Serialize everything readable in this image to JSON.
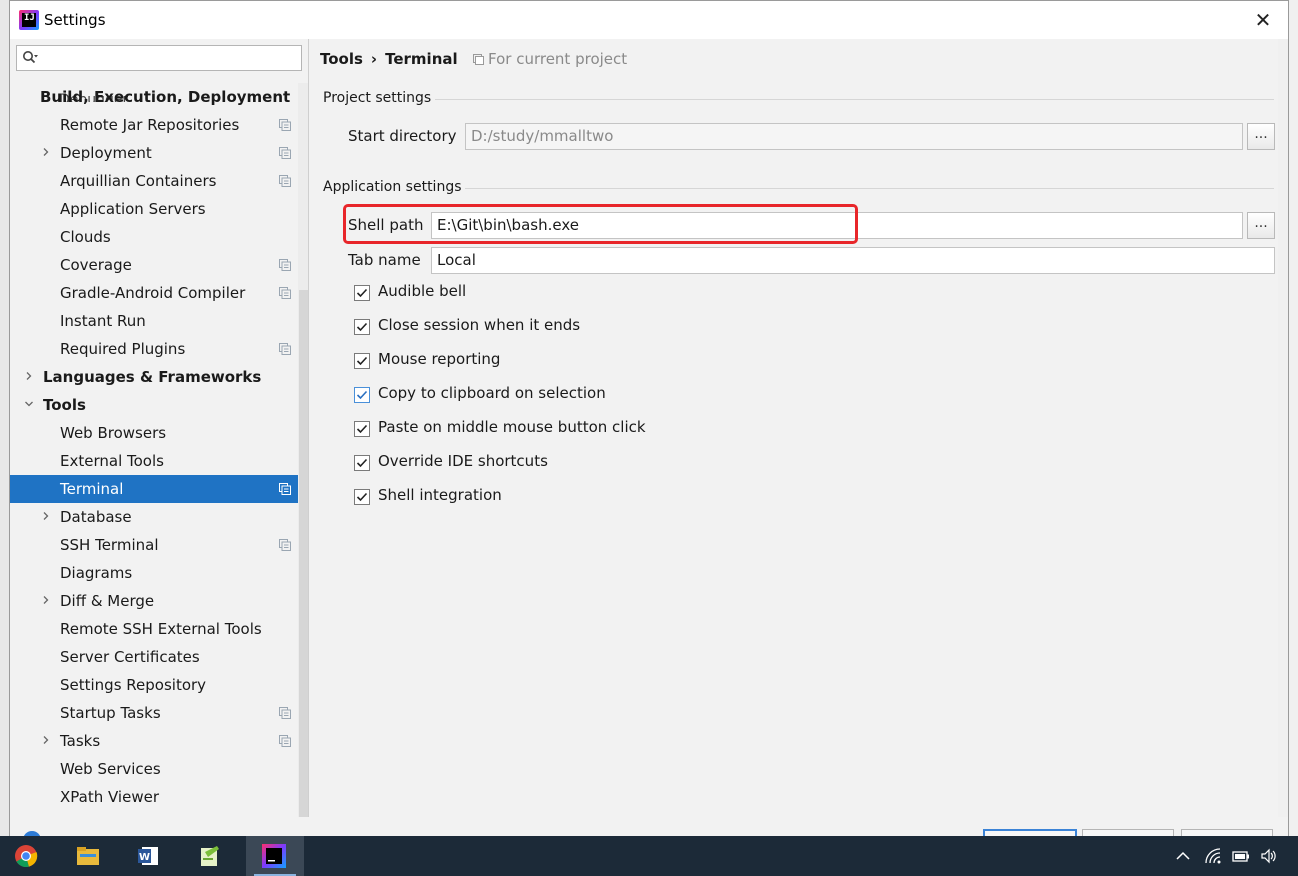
{
  "window": {
    "title": "Settings",
    "close_glyph": "✕"
  },
  "search": {
    "placeholder": ""
  },
  "tree": {
    "header": "Build, Execution, Deployment",
    "partial_item": "Debugger",
    "items": [
      {
        "label": "Remote Jar Repositories",
        "indent": 2,
        "expandable": false,
        "project_icon": true,
        "bold": false
      },
      {
        "label": "Deployment",
        "indent": 2,
        "expandable": true,
        "project_icon": true,
        "bold": false
      },
      {
        "label": "Arquillian Containers",
        "indent": 2,
        "expandable": false,
        "project_icon": true,
        "bold": false
      },
      {
        "label": "Application Servers",
        "indent": 2,
        "expandable": false,
        "project_icon": false,
        "bold": false
      },
      {
        "label": "Clouds",
        "indent": 2,
        "expandable": false,
        "project_icon": false,
        "bold": false
      },
      {
        "label": "Coverage",
        "indent": 2,
        "expandable": false,
        "project_icon": true,
        "bold": false
      },
      {
        "label": "Gradle-Android Compiler",
        "indent": 2,
        "expandable": false,
        "project_icon": true,
        "bold": false
      },
      {
        "label": "Instant Run",
        "indent": 2,
        "expandable": false,
        "project_icon": false,
        "bold": false
      },
      {
        "label": "Required Plugins",
        "indent": 2,
        "expandable": false,
        "project_icon": true,
        "bold": false
      },
      {
        "label": "Languages & Frameworks",
        "indent": 1,
        "expandable": true,
        "expanded": false,
        "project_icon": false,
        "bold": true
      },
      {
        "label": "Tools",
        "indent": 1,
        "expandable": true,
        "expanded": true,
        "project_icon": false,
        "bold": true
      },
      {
        "label": "Web Browsers",
        "indent": 2,
        "expandable": false,
        "project_icon": false,
        "bold": false
      },
      {
        "label": "External Tools",
        "indent": 2,
        "expandable": false,
        "project_icon": false,
        "bold": false
      },
      {
        "label": "Terminal",
        "indent": 2,
        "expandable": false,
        "project_icon": true,
        "bold": false,
        "selected": true
      },
      {
        "label": "Database",
        "indent": 2,
        "expandable": true,
        "project_icon": false,
        "bold": false
      },
      {
        "label": "SSH Terminal",
        "indent": 2,
        "expandable": false,
        "project_icon": true,
        "bold": false
      },
      {
        "label": "Diagrams",
        "indent": 2,
        "expandable": false,
        "project_icon": false,
        "bold": false
      },
      {
        "label": "Diff & Merge",
        "indent": 2,
        "expandable": true,
        "project_icon": false,
        "bold": false
      },
      {
        "label": "Remote SSH External Tools",
        "indent": 2,
        "expandable": false,
        "project_icon": false,
        "bold": false
      },
      {
        "label": "Server Certificates",
        "indent": 2,
        "expandable": false,
        "project_icon": false,
        "bold": false
      },
      {
        "label": "Settings Repository",
        "indent": 2,
        "expandable": false,
        "project_icon": false,
        "bold": false
      },
      {
        "label": "Startup Tasks",
        "indent": 2,
        "expandable": false,
        "project_icon": true,
        "bold": false
      },
      {
        "label": "Tasks",
        "indent": 2,
        "expandable": true,
        "project_icon": true,
        "bold": false
      },
      {
        "label": "Web Services",
        "indent": 2,
        "expandable": false,
        "project_icon": false,
        "bold": false
      },
      {
        "label": "XPath Viewer",
        "indent": 2,
        "expandable": false,
        "project_icon": false,
        "bold": false
      }
    ]
  },
  "content": {
    "breadcrumb": [
      "Tools",
      "Terminal"
    ],
    "breadcrumb_sep": "›",
    "scope": "For current project",
    "project_settings": {
      "title": "Project settings",
      "start_directory_label": "Start directory",
      "start_directory_value": "D:/study/mmalltwo",
      "browse_label": "..."
    },
    "application_settings": {
      "title": "Application settings",
      "shell_path_label": "Shell path",
      "shell_path_value": "E:\\Git\\bin\\bash.exe",
      "tab_name_label": "Tab name",
      "tab_name_value": "Local",
      "browse_label": "..."
    },
    "checkboxes": [
      {
        "label": "Audible bell",
        "checked": true
      },
      {
        "label": "Close session when it ends",
        "checked": true
      },
      {
        "label": "Mouse reporting",
        "checked": true
      },
      {
        "label": "Copy to clipboard on selection",
        "checked": true,
        "focused": true
      },
      {
        "label": "Paste on middle mouse button click",
        "checked": true
      },
      {
        "label": "Override IDE shortcuts",
        "checked": true
      },
      {
        "label": "Shell integration",
        "checked": true
      }
    ]
  },
  "colors": {
    "selection": "#1f73c4",
    "highlight_box": "#e8262a",
    "taskbar": "#1c2a38"
  },
  "taskbar": {
    "apps": [
      {
        "name": "chrome-icon",
        "active": false
      },
      {
        "name": "file-explorer-icon",
        "active": false
      },
      {
        "name": "word-icon",
        "active": false
      },
      {
        "name": "notepad-plus-plus-icon",
        "active": false
      },
      {
        "name": "intellij-idea-icon",
        "active": true
      }
    ],
    "tray": [
      "chevron-up-icon",
      "wifi-icon",
      "battery-icon",
      "volume-icon"
    ]
  }
}
